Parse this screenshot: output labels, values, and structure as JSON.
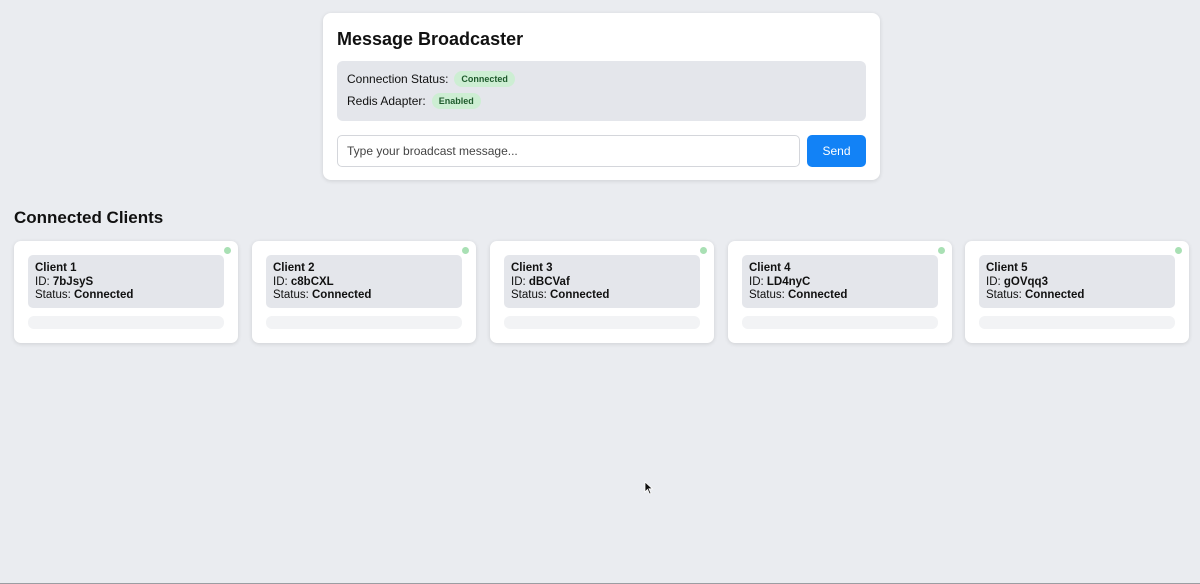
{
  "broadcaster": {
    "title": "Message Broadcaster",
    "connection_status_label": "Connection Status:",
    "connection_status_value": "Connected",
    "redis_label": "Redis Adapter:",
    "redis_value": "Enabled",
    "input_placeholder": "Type your broadcast message...",
    "send_label": "Send"
  },
  "clients_title": "Connected Clients",
  "clients": [
    {
      "name": "Client 1",
      "id_label": "ID: ",
      "id": "7bJsyS",
      "status_label": "Status: ",
      "status": "Connected"
    },
    {
      "name": "Client 2",
      "id_label": "ID: ",
      "id": "c8bCXL",
      "status_label": "Status: ",
      "status": "Connected"
    },
    {
      "name": "Client 3",
      "id_label": "ID: ",
      "id": "dBCVaf",
      "status_label": "Status: ",
      "status": "Connected"
    },
    {
      "name": "Client 4",
      "id_label": "ID: ",
      "id": "LD4nyC",
      "status_label": "Status: ",
      "status": "Connected"
    },
    {
      "name": "Client 5",
      "id_label": "ID: ",
      "id": "gOVqq3",
      "status_label": "Status: ",
      "status": "Connected"
    }
  ]
}
